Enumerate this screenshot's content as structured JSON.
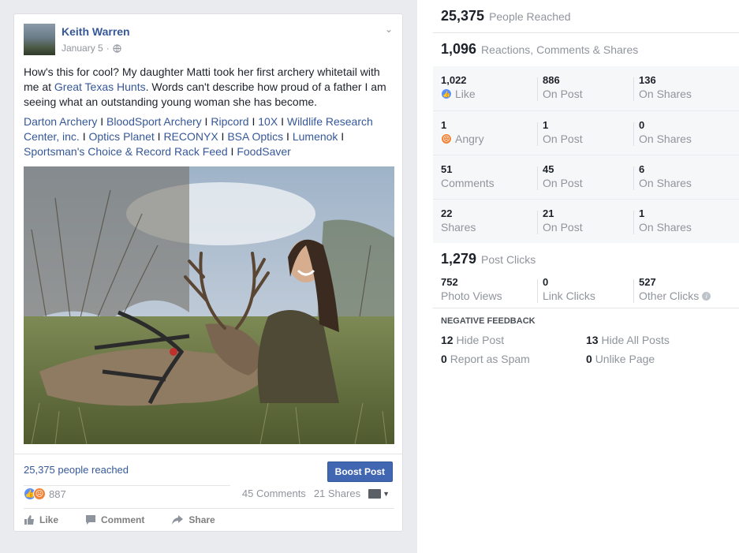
{
  "post": {
    "author": "Keith Warren",
    "date": "January 5",
    "text_before": "How's this for cool? My daughter Matti took her first archery whitetail with me at ",
    "text_link": "Great Texas Hunts",
    "text_after": ". Words can't describe how proud of a father I am seeing what an outstanding young woman she has become.",
    "tags": [
      "Darton Archery",
      "BloodSport Archery",
      "Ripcord",
      "10X",
      "Wildlife Research Center, inc.",
      "Optics Planet",
      "RECONYX",
      "BSA Optics",
      "Lumenok",
      "Sportsman's Choice & Record Rack Feed",
      "FoodSaver"
    ],
    "tag_separator": " I ",
    "tag_trailing": " I",
    "reach_text": "25,375 people reached",
    "boost_label": "Boost Post",
    "reaction_count": "887",
    "comments_text": "45 Comments",
    "shares_text": "21 Shares",
    "actions": {
      "like": "Like",
      "comment": "Comment",
      "share": "Share"
    }
  },
  "stats": {
    "people_reached": {
      "value": "25,375",
      "label": "People Reached"
    },
    "engagement": {
      "value": "1,096",
      "label": "Reactions, Comments & Shares"
    },
    "rows": [
      {
        "c1": {
          "value": "1,022",
          "label": "Like",
          "icon": "like-icon"
        },
        "c2": {
          "value": "886",
          "label": "On Post"
        },
        "c3": {
          "value": "136",
          "label": "On Shares"
        }
      },
      {
        "c1": {
          "value": "1",
          "label": "Angry",
          "icon": "angry-icon"
        },
        "c2": {
          "value": "1",
          "label": "On Post"
        },
        "c3": {
          "value": "0",
          "label": "On Shares"
        }
      },
      {
        "c1": {
          "value": "51",
          "label": "Comments"
        },
        "c2": {
          "value": "45",
          "label": "On Post"
        },
        "c3": {
          "value": "6",
          "label": "On Shares"
        }
      },
      {
        "c1": {
          "value": "22",
          "label": "Shares"
        },
        "c2": {
          "value": "21",
          "label": "On Post"
        },
        "c3": {
          "value": "1",
          "label": "On Shares"
        }
      }
    ],
    "post_clicks": {
      "value": "1,279",
      "label": "Post Clicks"
    },
    "clicks": {
      "c1": {
        "value": "752",
        "label": "Photo Views"
      },
      "c2": {
        "value": "0",
        "label": "Link Clicks"
      },
      "c3": {
        "value": "527",
        "label": "Other Clicks"
      }
    },
    "negative": {
      "title": "NEGATIVE FEEDBACK",
      "hide_post": {
        "value": "12",
        "label": "Hide Post"
      },
      "hide_all": {
        "value": "13",
        "label": "Hide All Posts"
      },
      "spam": {
        "value": "0",
        "label": "Report as Spam"
      },
      "unlike": {
        "value": "0",
        "label": "Unlike Page"
      }
    }
  },
  "colors": {
    "link": "#365899",
    "boost": "#4267b2",
    "like": "#5890ff",
    "angry": "#f0853a"
  }
}
